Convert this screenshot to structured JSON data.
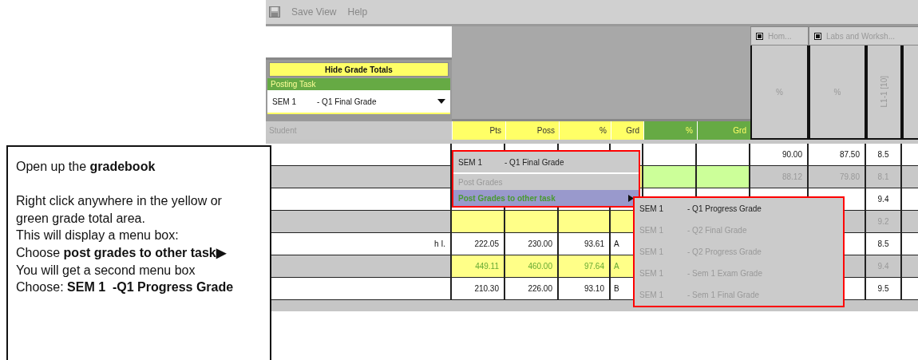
{
  "menubar": {
    "items": [
      "Save View",
      "Help"
    ]
  },
  "left_panel": {
    "hide_button": "Hide Grade Totals",
    "task_label": "Posting Task",
    "task_select": {
      "term": "SEM 1",
      "task": "- Q1 Final Grade"
    },
    "student_header": "Student"
  },
  "grade_headers": [
    {
      "label": "Pts",
      "kind": "term"
    },
    {
      "label": "Poss",
      "kind": "term"
    },
    {
      "label": "%",
      "kind": "term"
    },
    {
      "label": "Grd",
      "kind": "term"
    },
    {
      "label": "%",
      "kind": "total"
    },
    {
      "label": "Grd",
      "kind": "total"
    }
  ],
  "tabs": [
    {
      "label": "Hom..."
    },
    {
      "label": "Labs and Worksh..."
    }
  ],
  "columns": [
    {
      "label": "%",
      "kind": "plain"
    },
    {
      "label": "%",
      "kind": "plain"
    },
    {
      "label": "L1-1 [10]",
      "kind": "vertical"
    }
  ],
  "rows": [
    {
      "shaded": false,
      "column_1": "90.00",
      "column_2": "87.50",
      "column_3": "8.5"
    },
    {
      "shaded": true,
      "column_1": "88.12",
      "column_2": "79.80",
      "column_3": "8.1"
    },
    {
      "shaded": false,
      "column_3": "9.4"
    },
    {
      "shaded": true,
      "column_3": "9.2"
    },
    {
      "shaded": false,
      "student": "h I.",
      "pts": "222.05",
      "poss": "230.00",
      "pct": "93.61",
      "grade": "A",
      "column_3": "8.5"
    },
    {
      "shaded": true,
      "pts": "449.11",
      "poss": "460.00",
      "pct": "97.64",
      "grade": "A",
      "column_3": "9.4"
    },
    {
      "shaded": false,
      "pts": "210.30",
      "poss": "226.00",
      "pct": "93.10",
      "grade": "B",
      "column_3": "9.5"
    }
  ],
  "context_menu": {
    "items": [
      {
        "kind": "title",
        "term": "SEM 1",
        "task": "- Q1 Final Grade",
        "disabled": false,
        "selected": false
      },
      {
        "kind": "item",
        "label": "Post Grades",
        "disabled": true,
        "selected": false
      },
      {
        "kind": "submenu",
        "label": "Post Grades to other task",
        "disabled": false,
        "selected": true
      }
    ]
  },
  "submenu": {
    "items": [
      {
        "term": "SEM 1",
        "task": "- Q1 Progress Grade",
        "disabled": false
      },
      {
        "term": "SEM 1",
        "task": "- Q2 Final Grade",
        "disabled": true
      },
      {
        "term": "SEM 1",
        "task": "- Q2 Progress Grade",
        "disabled": true
      },
      {
        "term": "SEM 1",
        "task": "- Sem 1 Exam Grade",
        "disabled": true
      },
      {
        "term": "SEM 1",
        "task": "- Sem 1 Final Grade",
        "disabled": true
      }
    ]
  },
  "callout": {
    "paragraphs": [
      [
        "Open up the **gradebook**"
      ],
      [
        "Right click anywhere in the yellow or green grade total area.",
        "This will display a menu box:",
        "Choose **post grades to other task▶**",
        "You will get a second menu box",
        "Choose: **SEM 1  -Q1 Progress Grade**"
      ]
    ]
  }
}
